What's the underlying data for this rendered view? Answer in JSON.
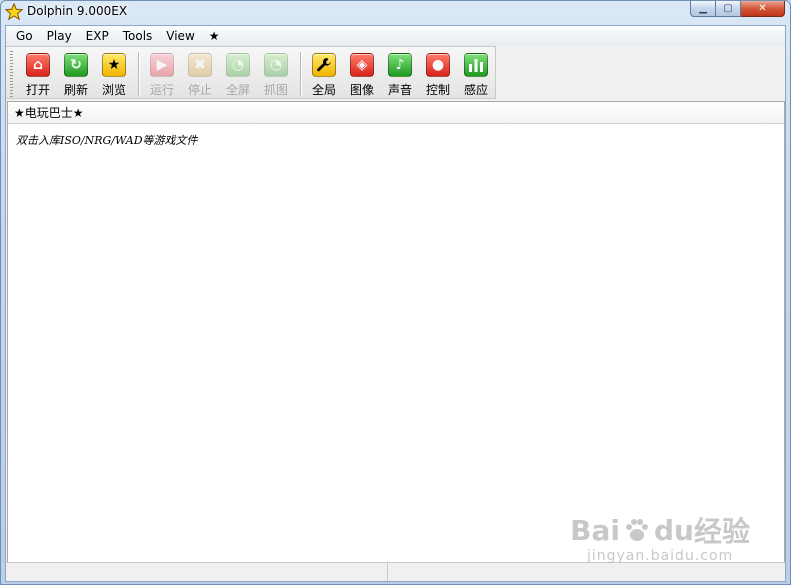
{
  "window": {
    "title": "Dolphin 9.000EX",
    "minimize_glyph": "▁",
    "maximize_glyph": "▢",
    "close_glyph": "✕"
  },
  "menu": [
    {
      "id": "go",
      "label": "Go"
    },
    {
      "id": "play",
      "label": "Play"
    },
    {
      "id": "exp",
      "label": "EXP"
    },
    {
      "id": "tools",
      "label": "Tools"
    },
    {
      "id": "view",
      "label": "View"
    },
    {
      "id": "star",
      "label": "★"
    }
  ],
  "toolbar": {
    "group1": [
      {
        "id": "open",
        "label": "打开",
        "icon": "home-icon",
        "glyph": "⌂",
        "color": "red",
        "enabled": true
      },
      {
        "id": "refresh",
        "label": "刷新",
        "icon": "refresh-icon",
        "glyph": "↻",
        "color": "green",
        "enabled": true
      },
      {
        "id": "browse",
        "label": "浏览",
        "icon": "star-icon",
        "glyph": "★",
        "color": "yellow",
        "enabled": true
      }
    ],
    "group2": [
      {
        "id": "run",
        "label": "运行",
        "icon": "play-icon",
        "glyph": "▶",
        "color": "pink",
        "enabled": false
      },
      {
        "id": "stop",
        "label": "停止",
        "icon": "stop-icon",
        "glyph": "✖",
        "color": "tan",
        "enabled": false
      },
      {
        "id": "fullscreen",
        "label": "全屏",
        "icon": "fullscreen-icon",
        "glyph": "◔",
        "color": "lime",
        "enabled": false
      },
      {
        "id": "screenshot",
        "label": "抓图",
        "icon": "screenshot-icon",
        "glyph": "◔",
        "color": "lime",
        "enabled": false
      }
    ],
    "group3": [
      {
        "id": "global",
        "label": "全局",
        "icon": "wrench-icon",
        "glyph": "🔧",
        "color": "yellow",
        "enabled": true
      },
      {
        "id": "graphics",
        "label": "图像",
        "icon": "graphics-icon",
        "glyph": "◈",
        "color": "red",
        "enabled": true
      },
      {
        "id": "audio",
        "label": "声音",
        "icon": "music-icon",
        "glyph": "♪",
        "color": "green",
        "enabled": true
      },
      {
        "id": "controls",
        "label": "控制",
        "icon": "controller-icon",
        "glyph": "●",
        "color": "red",
        "enabled": true
      },
      {
        "id": "sensor",
        "label": "感应",
        "icon": "bars-icon",
        "glyph": "▮",
        "color": "green",
        "enabled": true
      }
    ]
  },
  "list": {
    "header": "★电玩巴士★",
    "hint": "双击入库ISO/NRG/WAD等游戏文件"
  },
  "watermark": {
    "brand": "Bai",
    "brand_suffix": "du",
    "cn": "经验",
    "sub": "jingyan.baidu.com"
  }
}
